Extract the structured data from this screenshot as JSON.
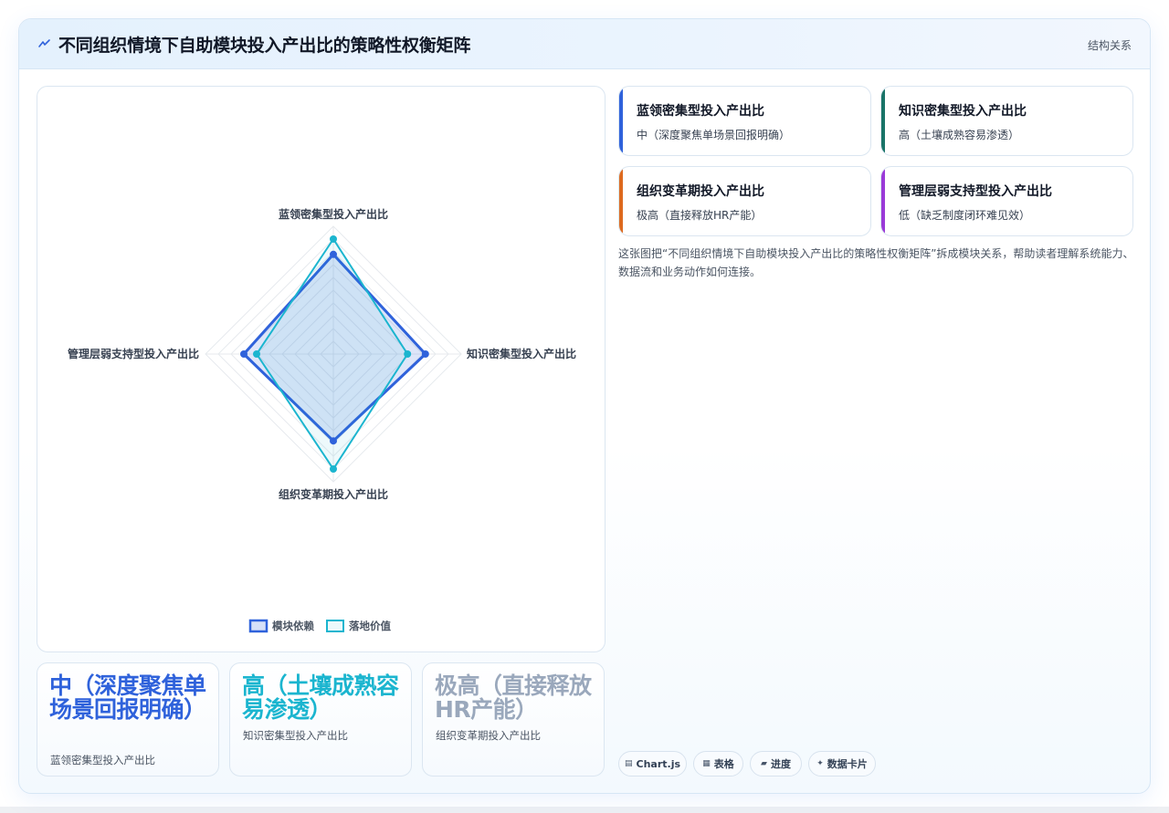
{
  "header": {
    "title": "不同组织情境下自助模块投入产出比的策略性权衡矩阵",
    "tag": "结构关系",
    "icon": "sparkle-icon"
  },
  "chart_data": {
    "type": "radar",
    "axes": [
      "蓝领密集型投入产出比",
      "知识密集型投入产出比",
      "组织变革期投入产出比",
      "管理层弱支持型投入产出比"
    ],
    "series": [
      {
        "name": "模块依赖",
        "values": [
          78,
          72,
          68,
          70
        ],
        "color": "#2f62db"
      },
      {
        "name": "落地价值",
        "values": [
          90,
          58,
          90,
          60
        ],
        "color": "#1bb5cf"
      }
    ],
    "range": [
      0,
      100
    ],
    "legend_position": "bottom"
  },
  "stats": [
    {
      "value": "中（深度聚焦单场景回报明确）",
      "label": "蓝领密集型投入产出比",
      "color": "#2f62db"
    },
    {
      "value": "高（土壤成熟容易渗透）",
      "label": "知识密集型投入产出比",
      "color": "#1bb5cf"
    },
    {
      "value": "极高（直接释放HR产能）",
      "label": "组织变革期投入产出比",
      "color": "#9aa8bc"
    }
  ],
  "info_cards": [
    {
      "title": "蓝领密集型投入产出比",
      "desc": "中（深度聚焦单场景回报明确）",
      "accent": "#2f62db"
    },
    {
      "title": "知识密集型投入产出比",
      "desc": "高（土壤成熟容易渗透）",
      "accent": "#1a7468"
    },
    {
      "title": "组织变革期投入产出比",
      "desc": "极高（直接释放HR产能）",
      "accent": "#dd6a1f"
    },
    {
      "title": "管理层弱支持型投入产出比",
      "desc": "低（缺乏制度闭环难见效）",
      "accent": "#9a3ad8"
    }
  ],
  "description": "这张图把“不同组织情境下自助模块投入产出比的策略性权衡矩阵”拆成模块关系，帮助读者理解系统能力、数据流和业务动作如何连接。",
  "chips": [
    {
      "label": "Chart.js",
      "icon": "▤"
    },
    {
      "label": "表格",
      "icon": "▦"
    },
    {
      "label": "进度",
      "icon": "▰"
    },
    {
      "label": "数据卡片",
      "icon": "✦"
    }
  ]
}
